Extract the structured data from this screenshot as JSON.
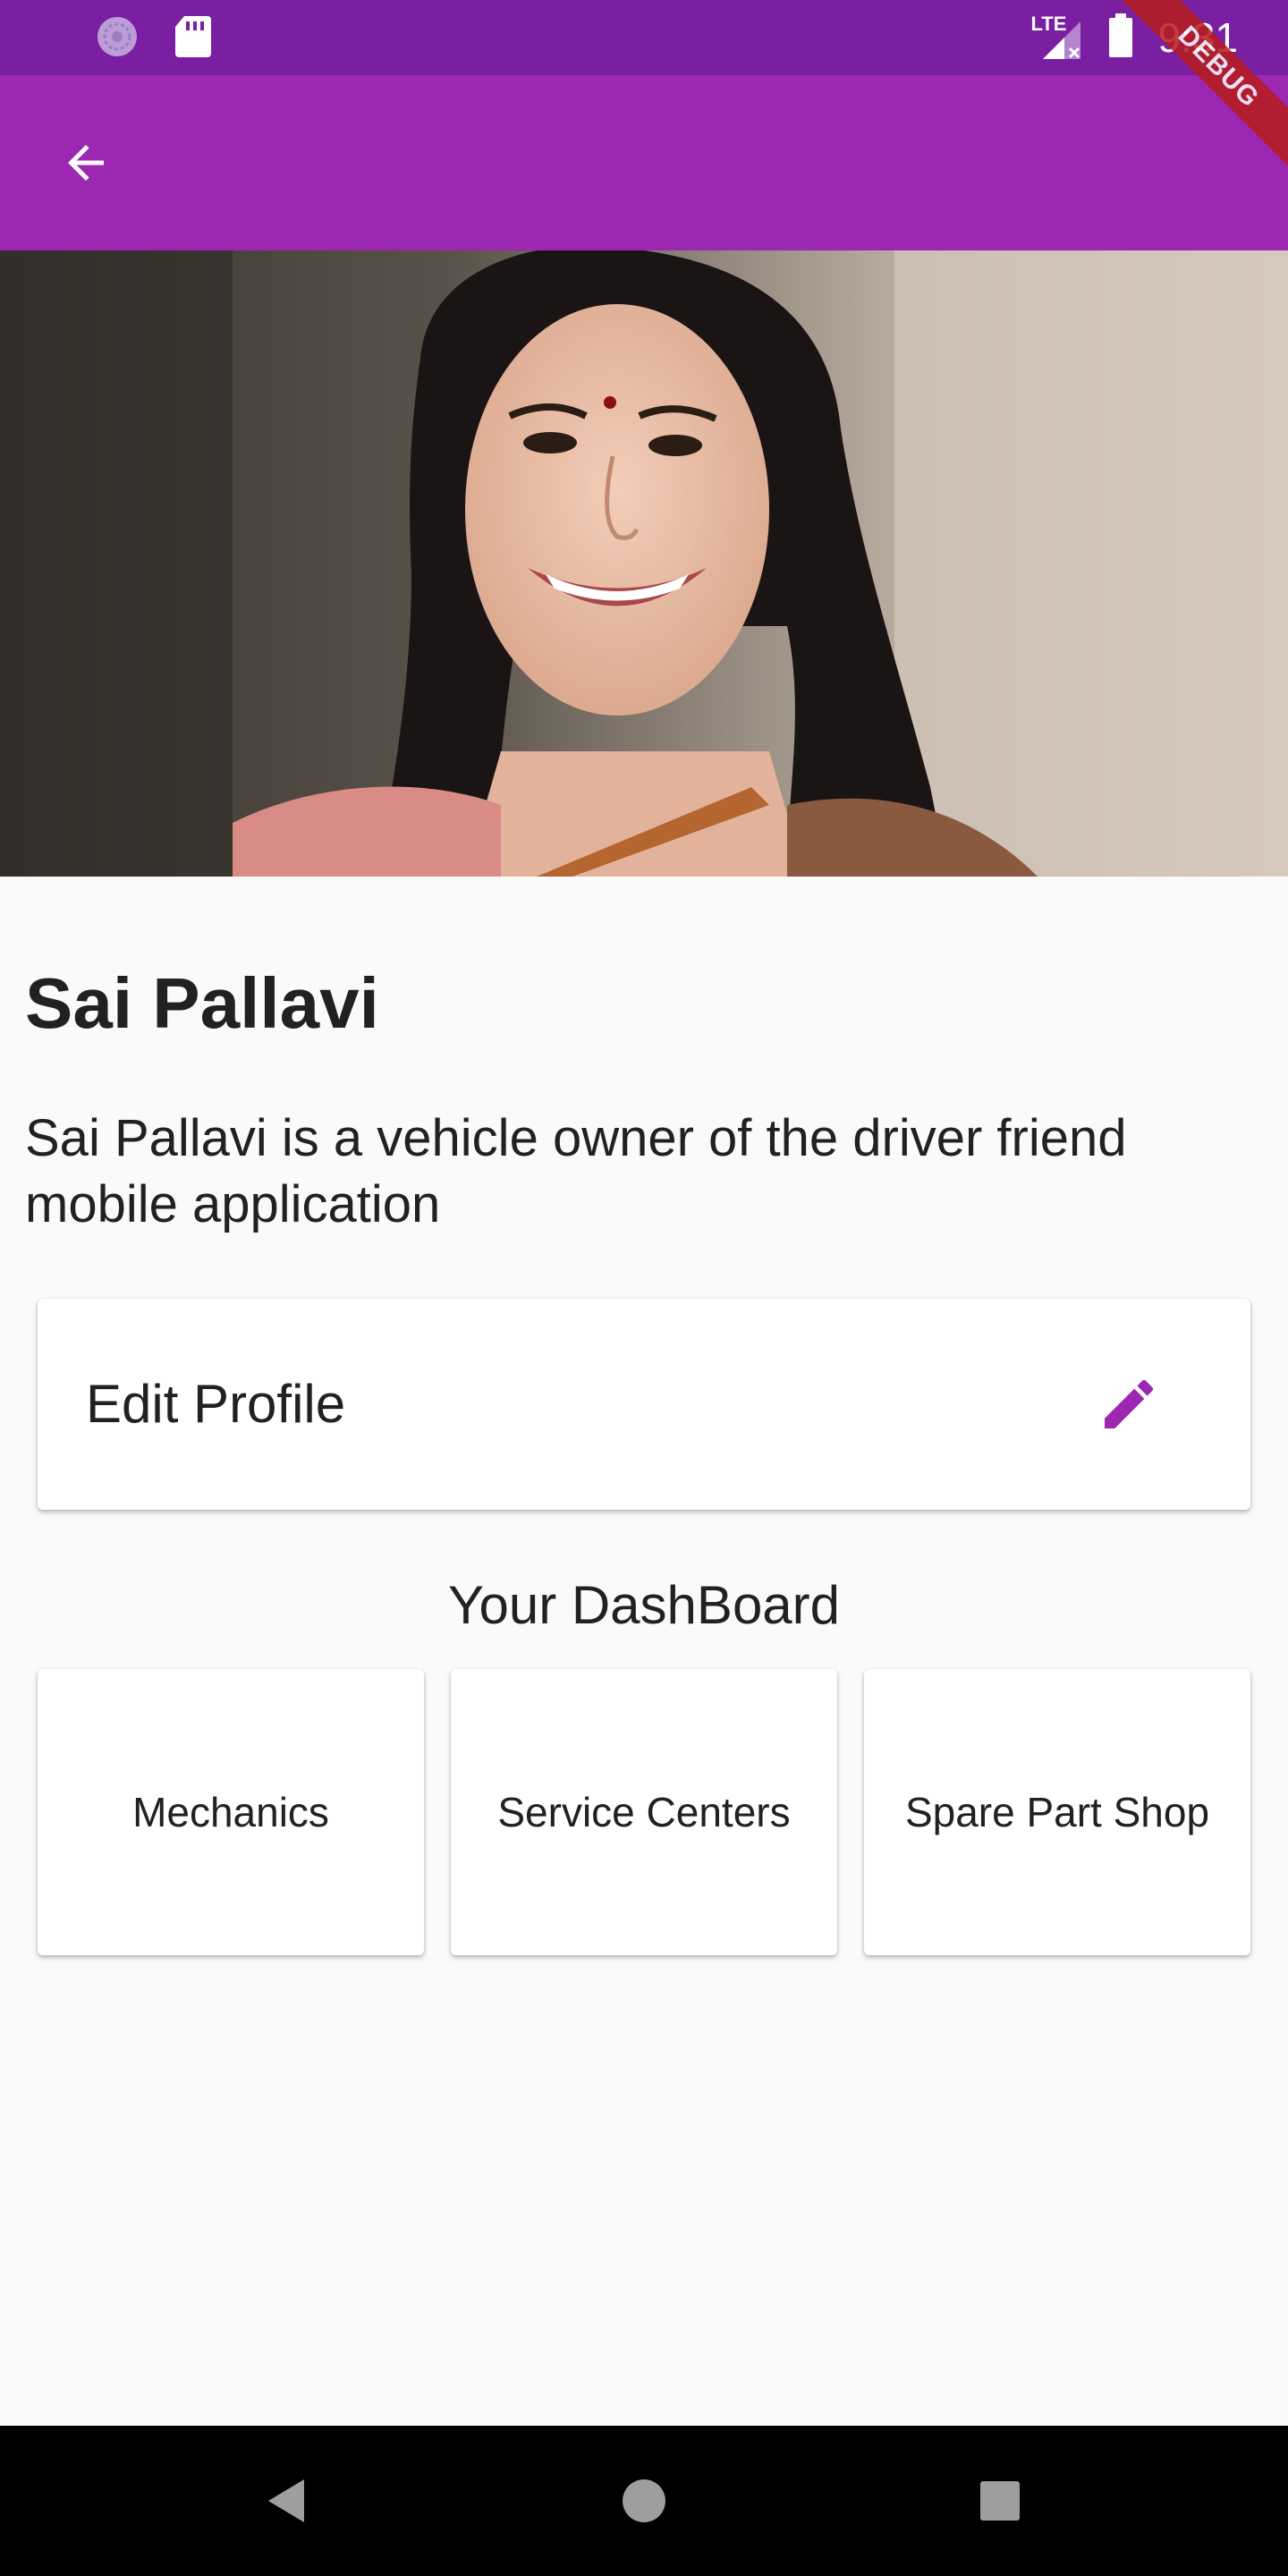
{
  "status_bar": {
    "time": "9:31",
    "network": "LTE",
    "icons": [
      "sync-status-icon",
      "sd-card-icon",
      "signal-icon",
      "battery-icon"
    ]
  },
  "debug_banner": "DEBUG",
  "app_bar": {
    "back_icon": "arrow-back-icon"
  },
  "profile": {
    "name": "Sai Pallavi",
    "description": "Sai Pallavi is a vehicle owner of the driver friend mobile application"
  },
  "edit_profile": {
    "label": "Edit Profile",
    "icon": "pencil-icon"
  },
  "dashboard": {
    "title": "Your DashBoard",
    "tiles": [
      {
        "label": "Mechanics"
      },
      {
        "label": "Service Centers"
      },
      {
        "label": "Spare Part Shop"
      }
    ]
  },
  "nav_bar": {
    "icons": [
      "nav-back-icon",
      "nav-home-icon",
      "nav-recents-icon"
    ]
  },
  "colors": {
    "status_bar": "#7b1fa2",
    "app_bar": "#9c27b0",
    "accent": "#9c27b0",
    "background": "#fafafa"
  }
}
